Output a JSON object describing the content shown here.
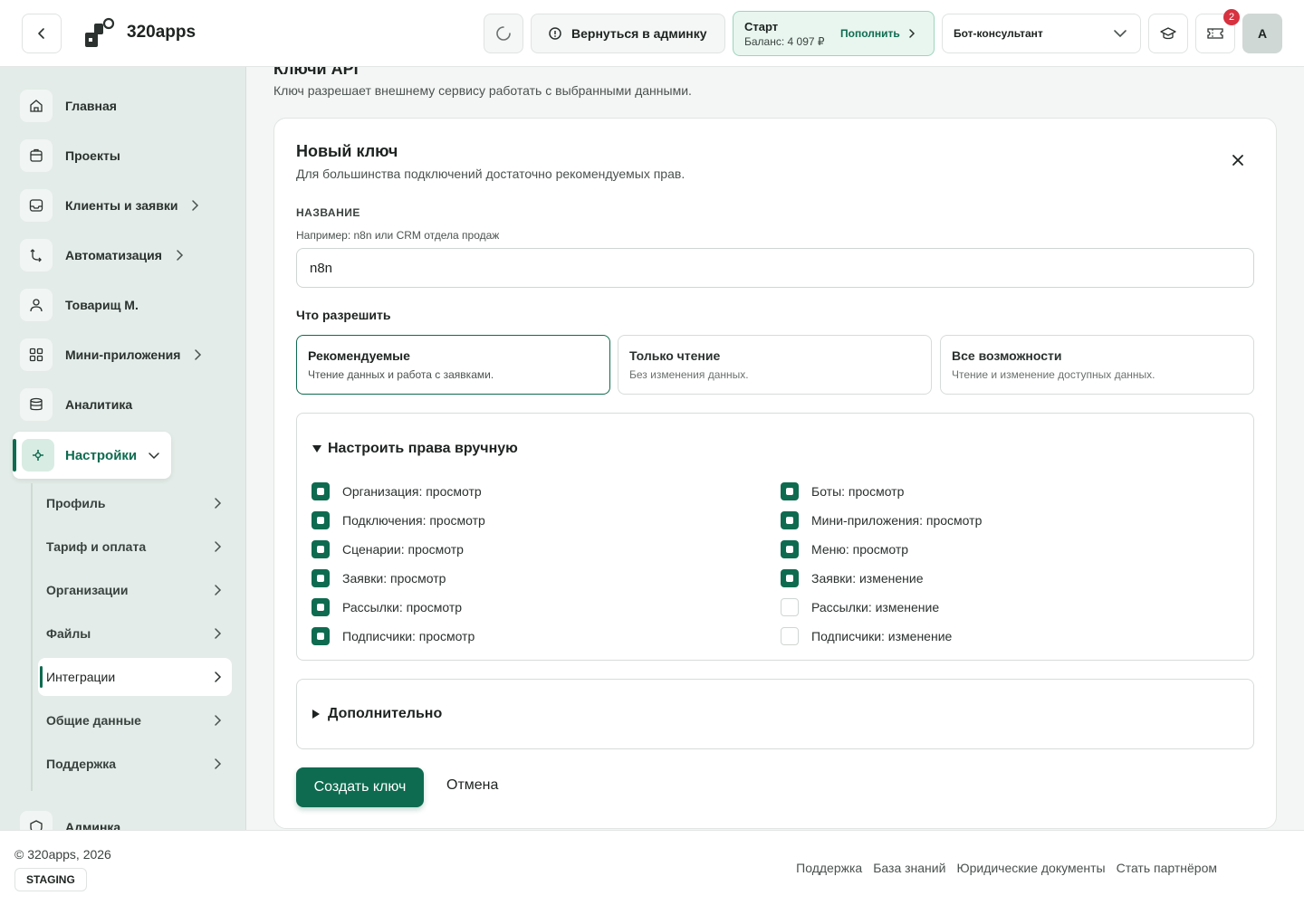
{
  "header": {
    "brand": "320apps",
    "admin_button": "Вернуться в админку",
    "plan": {
      "name": "Старт",
      "balance": "Баланс: 4 097 ₽",
      "topup": "Пополнить"
    },
    "bot_select": "Бот-консультант",
    "notifications_count": "2",
    "avatar_letter": "A"
  },
  "sidebar": {
    "items": [
      {
        "label": "Главная",
        "icon": "home-icon"
      },
      {
        "label": "Проекты",
        "icon": "briefcase-icon"
      },
      {
        "label": "Клиенты и заявки",
        "icon": "inbox-icon"
      },
      {
        "label": "Автоматизация",
        "icon": "automation-icon"
      },
      {
        "label": "Товарищ М.",
        "icon": "user-icon"
      },
      {
        "label": "Мини-приложения",
        "icon": "apps-icon"
      },
      {
        "label": "Аналитика",
        "icon": "database-icon"
      }
    ],
    "settings": {
      "label": "Настройки",
      "icon": "settings-icon"
    },
    "sub_items": [
      "Профиль",
      "Тариф и оплата",
      "Организации",
      "Файлы",
      "Интеграции",
      "Общие данные",
      "Поддержка"
    ],
    "cut_item": "Админка"
  },
  "main": {
    "cut_title": "Ключи API",
    "description": "Ключ разрешает внешнему сервису работать с выбранными данными.",
    "card": {
      "title": "Новый ключ",
      "subtitle": "Для большинства подключений достаточно рекомендуемых прав.",
      "name_label": "НАЗВАНИЕ",
      "name_hint": "Например: n8n или CRM отдела продаж",
      "name_value": "n8n",
      "allow_label": "Что разрешить",
      "presets": [
        {
          "title": "Рекомендуемые",
          "desc": "Чтение данных и работа с заявками.",
          "selected": true
        },
        {
          "title": "Только чтение",
          "desc": "Без изменения данных.",
          "selected": false
        },
        {
          "title": "Все возможности",
          "desc": "Чтение и изменение доступных данных.",
          "selected": false
        }
      ],
      "manual_label": "Настроить права вручную",
      "permissions_left": [
        {
          "label": "Организация: просмотр",
          "checked": true
        },
        {
          "label": "Подключения: просмотр",
          "checked": true
        },
        {
          "label": "Сценарии: просмотр",
          "checked": true
        },
        {
          "label": "Заявки: просмотр",
          "checked": true
        },
        {
          "label": "Рассылки: просмотр",
          "checked": true
        },
        {
          "label": "Подписчики: просмотр",
          "checked": true
        }
      ],
      "permissions_right": [
        {
          "label": "Боты: просмотр",
          "checked": true
        },
        {
          "label": "Мини-приложения: просмотр",
          "checked": true
        },
        {
          "label": "Меню: просмотр",
          "checked": true
        },
        {
          "label": "Заявки: изменение",
          "checked": true
        },
        {
          "label": "Рассылки: изменение",
          "checked": false
        },
        {
          "label": "Подписчики: изменение",
          "checked": false
        }
      ],
      "extra_label": "Дополнительно",
      "create_button": "Создать ключ",
      "cancel_button": "Отмена"
    }
  },
  "footer": {
    "copyright": "© 320apps, 2026",
    "env_badge": "STAGING",
    "links": [
      "Поддержка",
      "База знаний",
      "Юридические документы",
      "Стать партнёром"
    ]
  },
  "colors": {
    "accent": "#0e6b4f",
    "sidebar_bg": "#e3ece8",
    "plan_bg": "#e8f6ef",
    "badge": "#d7323f"
  }
}
